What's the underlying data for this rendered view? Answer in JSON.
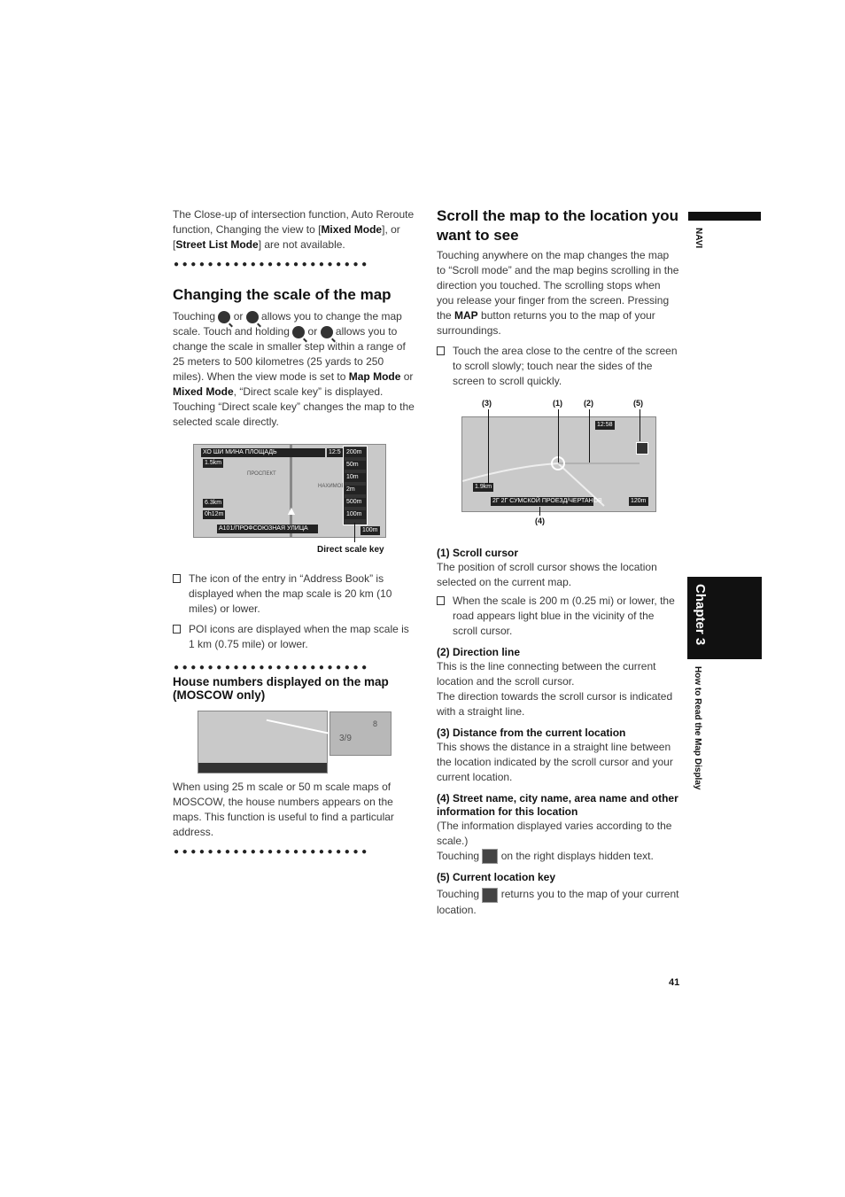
{
  "left": {
    "intro": [
      "The Close-up of intersection function, Auto Reroute function, Changing the view to [",
      "Mixed Mode",
      "], or [",
      "Street List Mode",
      "] are not available."
    ],
    "section1": {
      "title": "Changing the scale of the map",
      "p1a": "Touching ",
      "p1b": " or ",
      "p1c": " allows you to change the map scale. Touch and holding ",
      "p1d": " or ",
      "p1e": " allows you to change the scale in smaller step within a range of 25 meters to 500 kilometres (25 yards to 250 miles). When the view mode is set to ",
      "p1f": "Map Mode",
      "p1g": " or ",
      "p1h": "Mixed Mode",
      "p1i": ", “Direct scale key” is displayed. Touching “Direct scale key” changes the map to the selected scale directly.",
      "figure": {
        "street": "ХО ШИ МИНА ПЛОЩАДЬ",
        "dist1": "1.5km",
        "road1": "ПРОСПЕКТ",
        "road2": "НАХИМОВСКИЙ",
        "dist2": "6.3km",
        "time": "0h12m",
        "bottom": "А101/ПРОФСОЮЗНАЯ УЛИЦА",
        "clock": "12:5",
        "scales": [
          "200m",
          "50m",
          "10m",
          "2m",
          "500m",
          "100m"
        ],
        "scale_bottom": "100m",
        "callout": "Direct scale key"
      },
      "bullets": [
        "The icon of the entry in “Address Book” is displayed when the map scale is 20 km (10 miles) or lower.",
        "POI icons are displayed when the map scale is 1 km (0.75 mile) or lower."
      ]
    },
    "section2": {
      "title": "House numbers displayed on the map (MOSCOW only)",
      "figure": {
        "house": "3/9",
        "house2": "8"
      },
      "p": "When using 25 m scale or 50 m scale maps of MOSCOW, the house numbers appears on the maps. This function is useful to find a particular address."
    }
  },
  "right": {
    "title": "Scroll the map to the location you want to see",
    "p1a": "Touching anywhere on the map changes the map to “Scroll mode” and the map begins scrolling in the direction you touched. The scrolling stops when you release your finger from the screen. Pressing the ",
    "p1b": "MAP",
    "p1c": " button returns you to the map of your surroundings.",
    "bullet1": "Touch the area close to the centre of the screen to scroll slowly; touch near the sides of the screen to scroll quickly.",
    "figure": {
      "labels": [
        "(3)",
        "(1)",
        "(2)",
        "(5)",
        "(4)"
      ],
      "clock": "12:58",
      "dist": "1.9km",
      "street": "2Г 2Г СУМСКОЙ ПРОЕЗД/ЧЕРТАНОВ",
      "scale": "120m"
    },
    "items": [
      {
        "title": "(1) Scroll cursor",
        "text": "The position of scroll cursor shows the location selected on the current map.",
        "bullet": "When the scale is 200 m (0.25 mi) or lower, the road appears light blue in the vicinity of the scroll cursor."
      },
      {
        "title": "(2) Direction line",
        "text": "This is the line connecting between the current location and the scroll cursor.",
        "text2": "The direction towards the scroll cursor is indicated with a straight line."
      },
      {
        "title": "(3) Distance from the current location",
        "text": "This shows the distance in a straight line between the location indicated by the scroll cursor and your current location."
      },
      {
        "title": "(4) Street name, city name, area name and other information for this location",
        "text": "(The information displayed varies according to the scale.)",
        "text2a": "Touching ",
        "text2b": " on the right displays hidden text."
      },
      {
        "title": "(5) Current location key",
        "texta": "Touching ",
        "textb": " returns you to the map of your current location."
      }
    ]
  },
  "side": {
    "navi": "NAVI",
    "chapter": "Chapter 3",
    "section": "How to Read the Map Display"
  },
  "page_number": "41"
}
